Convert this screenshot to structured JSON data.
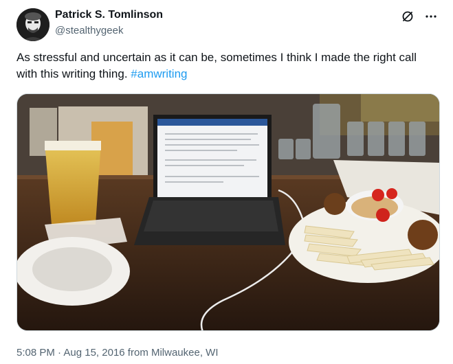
{
  "author": {
    "display_name": "Patrick S. Tomlinson",
    "handle": "@stealthygeek",
    "avatar_icon": "user-avatar"
  },
  "header_icons": {
    "mute_icon": "slashed-circle-icon",
    "more_icon": "ellipsis-icon"
  },
  "tweet": {
    "text": "As stressful and uncertain as it can be, sometimes I think I made the right call with this writing thing. ",
    "hashtag": "#amwriting",
    "image_icon": "photo"
  },
  "meta": {
    "time": "5:08 PM",
    "separator": " · ",
    "date": "Aug 15, 2016",
    "location": " from Milwaukee, WI"
  },
  "colors": {
    "link": "#1d9bf0",
    "secondary_text": "#536471",
    "primary_text": "#0f1419"
  }
}
